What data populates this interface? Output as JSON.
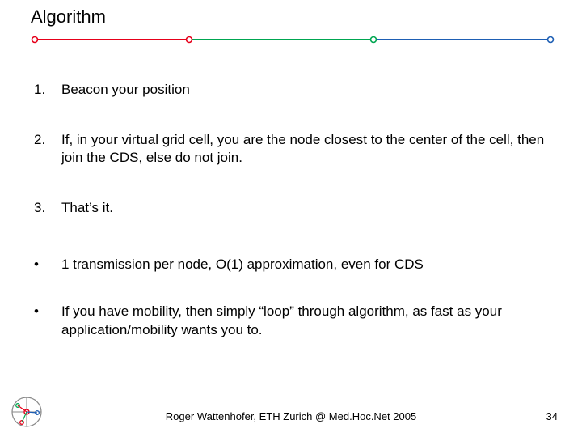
{
  "title": "Algorithm",
  "items": [
    {
      "marker": "1.",
      "text": "Beacon your position"
    },
    {
      "marker": "2.",
      "text": "If, in your virtual grid cell, you are the node closest to the center of the cell, then join the CDS, else do not join."
    },
    {
      "marker": "3.",
      "text": "That’s it."
    },
    {
      "marker": "•",
      "text": "1 transmission per node, O(1) approximation, even for CDS"
    },
    {
      "marker": "•",
      "text": "If you have mobility, then simply “loop” through algorithm, as fast as your application/mobility wants you to."
    }
  ],
  "footer": "Roger Wattenhofer, ETH Zurich @ Med.Hoc.Net 2005",
  "page": "34",
  "colors": {
    "red": "#e6001a",
    "green": "#00a651",
    "blue": "#1e5fb4"
  }
}
